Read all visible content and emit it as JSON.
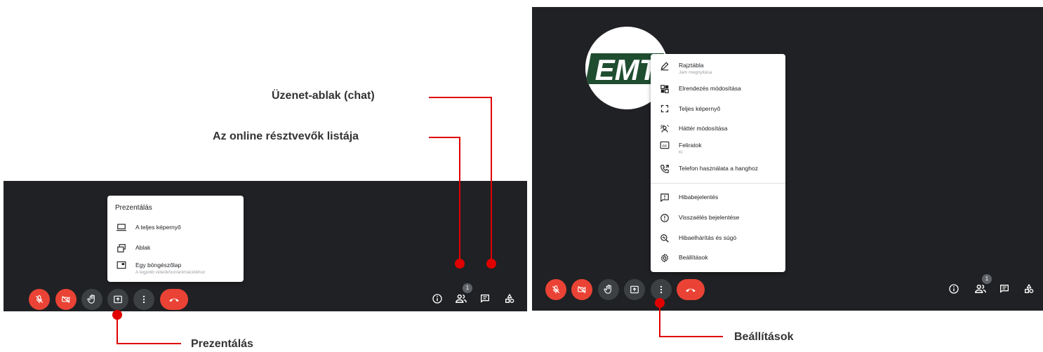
{
  "annotations": {
    "chat": "Üzenet-ablak (chat)",
    "participants": "Az online résztvevők listája",
    "presenting": "Prezentálás",
    "settings": "Beállítások"
  },
  "present_menu": {
    "title": "Prezentálás",
    "items": [
      {
        "label": "A teljes képernyő",
        "sub": "",
        "icon": "laptop-icon"
      },
      {
        "label": "Ablak",
        "sub": "",
        "icon": "window-icon"
      },
      {
        "label": "Egy böngészőlap",
        "sub": "A legjobb videókhoz/animációkhoz",
        "icon": "browser-tab-icon"
      }
    ]
  },
  "more_menu": {
    "items": [
      {
        "label": "Rajztábla",
        "sub": "Jam megnyitása",
        "icon": "pencil-icon"
      },
      {
        "label": "Elrendezés módosítása",
        "sub": "",
        "icon": "layout-icon"
      },
      {
        "label": "Teljes képernyő",
        "sub": "",
        "icon": "fullscreen-icon"
      },
      {
        "label": "Háttér módosítása",
        "sub": "",
        "icon": "background-icon"
      },
      {
        "label": "Feliratok",
        "sub": "Ki",
        "icon": "captions-icon"
      },
      {
        "label": "Telefon használata a hanghoz",
        "sub": "",
        "icon": "phone-audio-icon"
      },
      {
        "label": "Hibabejelentés",
        "sub": "",
        "icon": "feedback-icon"
      },
      {
        "label": "Visszaélés bejelentése",
        "sub": "",
        "icon": "report-abuse-icon"
      },
      {
        "label": "Hibaelhárítás és súgó",
        "sub": "",
        "icon": "troubleshoot-icon"
      },
      {
        "label": "Beállítások",
        "sub": "",
        "icon": "settings-gear-icon"
      }
    ]
  },
  "participants_count": "1",
  "avatar_logo_text": "EMT",
  "colors": {
    "panel": "#202124",
    "red": "#ea4335",
    "grey_button": "#3c4043",
    "annotation_red": "#e00000"
  }
}
